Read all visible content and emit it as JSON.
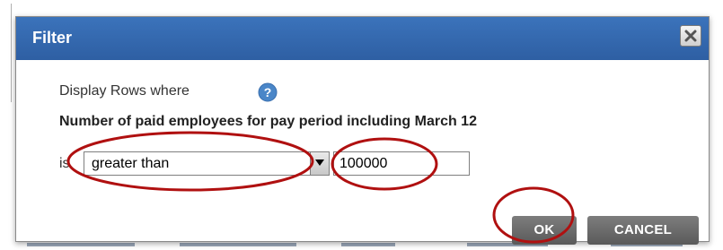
{
  "dialog": {
    "title": "Filter",
    "close_icon": "close-icon",
    "prompt": "Display Rows where",
    "help_icon": "help-icon",
    "column_name": "Number of paid employees for pay period including March 12",
    "condition_label": "is",
    "operator": {
      "selected": "greater than"
    },
    "value": "100000",
    "ok_label": "OK",
    "cancel_label": "CANCEL"
  },
  "colors": {
    "titlebar": "#2e5fa3",
    "annotation": "#b01010",
    "button": "#666666"
  }
}
